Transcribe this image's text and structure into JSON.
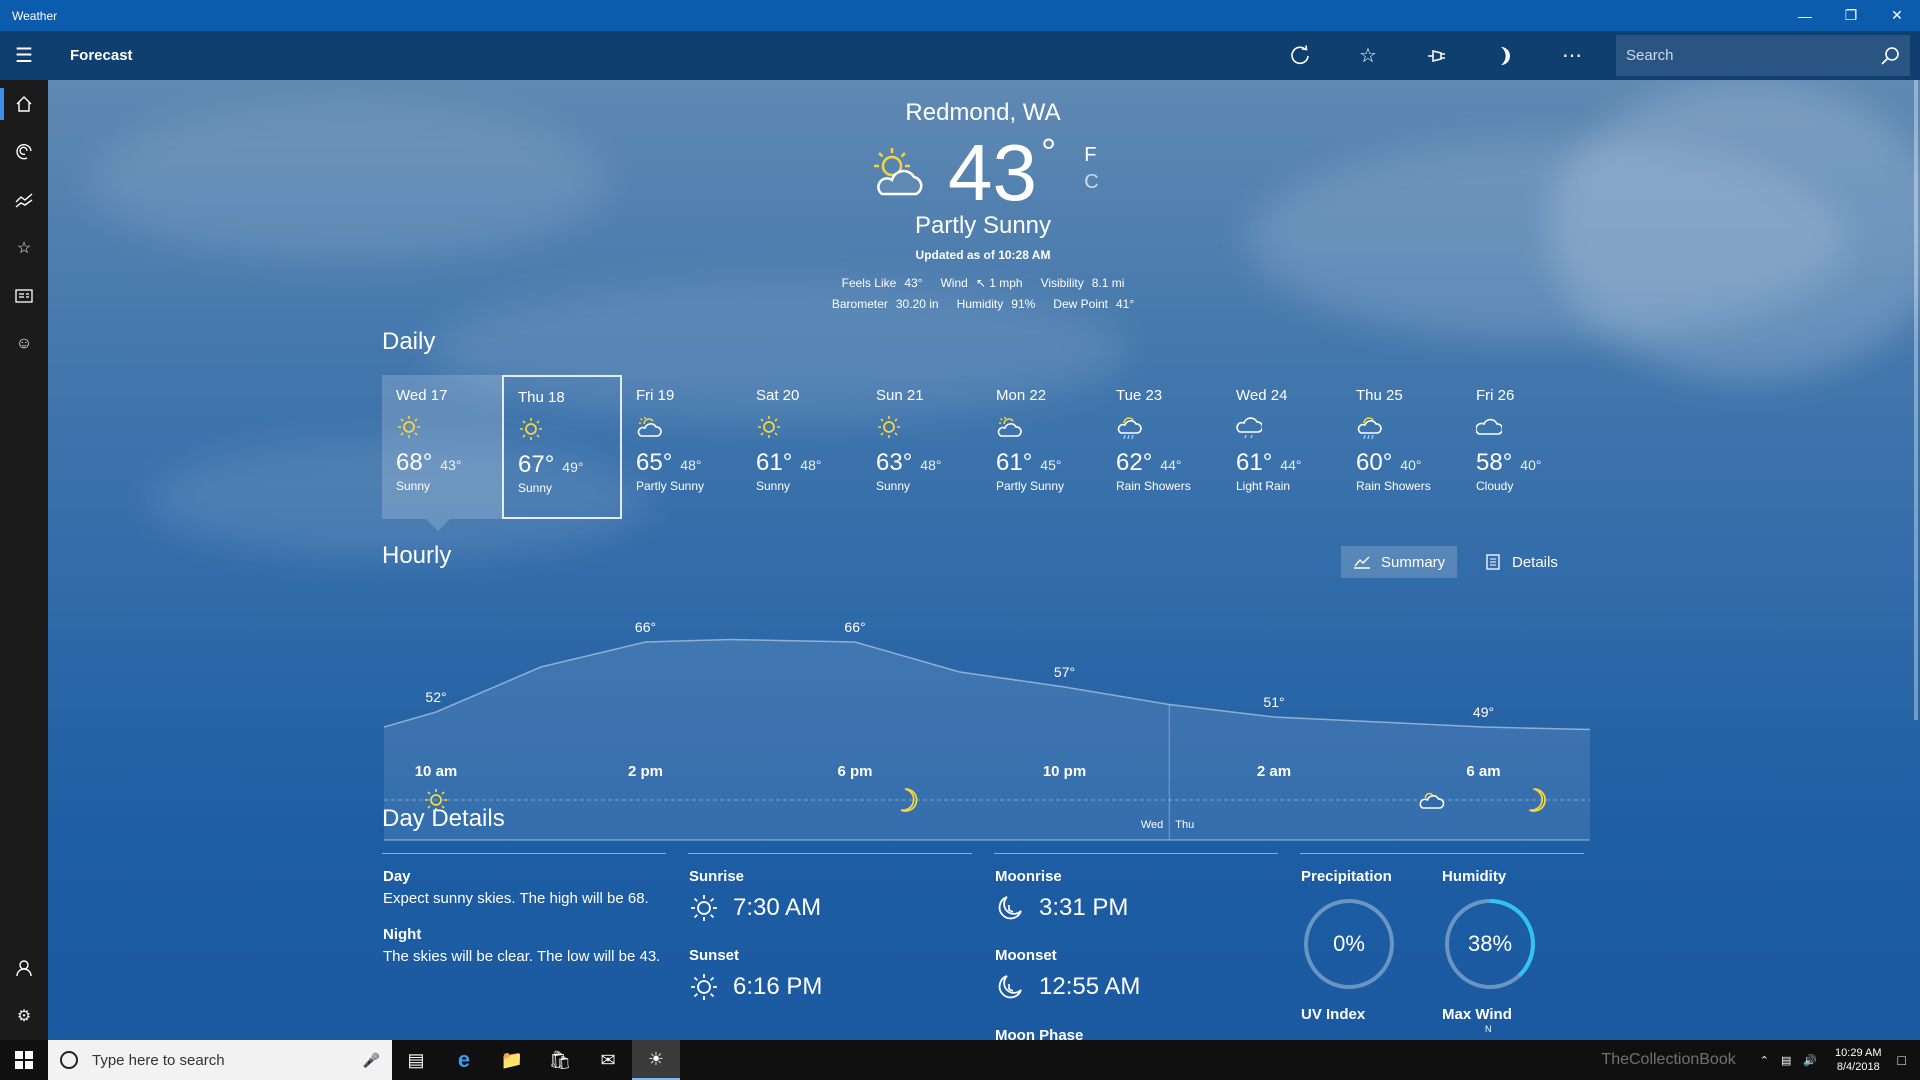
{
  "window": {
    "title": "Weather"
  },
  "appbar": {
    "page_title": "Forecast",
    "search_placeholder": "Search"
  },
  "current": {
    "location": "Redmond, WA",
    "temp": "43",
    "deg": "°",
    "unit_f": "F",
    "unit_c": "C",
    "condition": "Partly Sunny",
    "updated": "Updated as of 10:28 AM",
    "stats_row1": [
      {
        "label": "Feels Like",
        "value": "43°"
      },
      {
        "label": "Wind",
        "value": "↖ 1 mph"
      },
      {
        "label": "Visibility",
        "value": "8.1 mi"
      }
    ],
    "stats_row2": [
      {
        "label": "Barometer",
        "value": "30.20 in"
      },
      {
        "label": "Humidity",
        "value": "91%"
      },
      {
        "label": "Dew Point",
        "value": "41°"
      }
    ]
  },
  "daily": {
    "title": "Daily",
    "days": [
      {
        "day": "Wed 17",
        "hi": "68°",
        "lo": "43°",
        "cond": "Sunny",
        "icon": "sun-icon"
      },
      {
        "day": "Thu 18",
        "hi": "67°",
        "lo": "49°",
        "cond": "Sunny",
        "icon": "sun-icon"
      },
      {
        "day": "Fri 19",
        "hi": "65°",
        "lo": "48°",
        "cond": "Partly Sunny",
        "icon": "partly-sunny-icon"
      },
      {
        "day": "Sat 20",
        "hi": "61°",
        "lo": "48°",
        "cond": "Sunny",
        "icon": "sun-icon"
      },
      {
        "day": "Sun 21",
        "hi": "63°",
        "lo": "48°",
        "cond": "Sunny",
        "icon": "sun-icon"
      },
      {
        "day": "Mon 22",
        "hi": "61°",
        "lo": "45°",
        "cond": "Partly Sunny",
        "icon": "partly-sunny-icon"
      },
      {
        "day": "Tue 23",
        "hi": "62°",
        "lo": "44°",
        "cond": "Rain Showers",
        "icon": "rain-showers-icon"
      },
      {
        "day": "Wed 24",
        "hi": "61°",
        "lo": "44°",
        "cond": "Light Rain",
        "icon": "light-rain-icon"
      },
      {
        "day": "Thu 25",
        "hi": "60°",
        "lo": "40°",
        "cond": "Rain Showers",
        "icon": "rain-showers-icon"
      },
      {
        "day": "Fri 26",
        "hi": "58°",
        "lo": "40°",
        "cond": "Cloudy",
        "icon": "cloudy-icon"
      }
    ]
  },
  "hourly": {
    "title": "Hourly",
    "summary_label": "Summary",
    "details_label": "Details",
    "temps": [
      {
        "label": "52°",
        "value": 52
      },
      {
        "label": "66°",
        "value": 66
      },
      {
        "label": "66°",
        "value": 66
      },
      {
        "label": "57°",
        "value": 57
      },
      {
        "label": "51°",
        "value": 51
      },
      {
        "label": "49°",
        "value": 49
      }
    ],
    "time_labels": [
      "10 am",
      "2 pm",
      "6 pm",
      "10 pm",
      "2 am",
      "6 am"
    ],
    "day_divider": {
      "left": "Wed",
      "right": "Thu"
    },
    "icons": [
      "sun-icon",
      "moon-icon",
      "partly-cloudy-icon",
      "moon-icon"
    ]
  },
  "day_details": {
    "title": "Day Details",
    "day_label": "Day",
    "day_text": "Expect sunny skies. The high will be 68.",
    "night_label": "Night",
    "night_text": "The skies will be clear. The low will be 43.",
    "sunrise_label": "Sunrise",
    "sunrise": "7:30 AM",
    "sunset_label": "Sunset",
    "sunset": "6:16 PM",
    "moonrise_label": "Moonrise",
    "moonrise": "3:31 PM",
    "moonset_label": "Moonset",
    "moonset": "12:55 AM",
    "moon_phase_label": "Moon Phase",
    "precip_label": "Precipitation",
    "precip": "0%",
    "precip_value": 0,
    "humidity_label": "Humidity",
    "humidity": "38%",
    "humidity_value": 38,
    "uv_label": "UV Index",
    "wind_label": "Max Wind",
    "wind_dir": "N"
  },
  "taskbar": {
    "search_placeholder": "Type here to search",
    "time": "10:29 AM",
    "date": "8/4/2018",
    "watermark": "TheCollectionBook"
  },
  "colors": {
    "accent": "#0b5cad",
    "ring": "#33c3f0"
  }
}
